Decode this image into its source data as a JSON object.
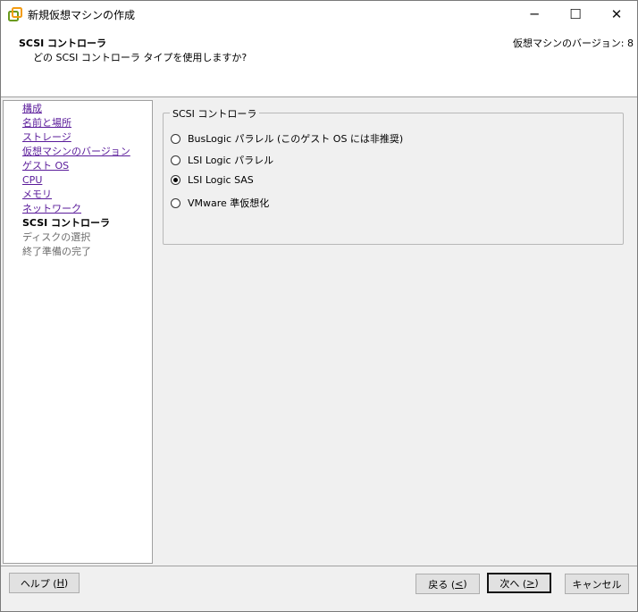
{
  "window": {
    "title": "新規仮想マシンの作成",
    "minimize_glyph": "─",
    "maximize_glyph": "☐",
    "close_glyph": "✕"
  },
  "header": {
    "title": "SCSI コントローラ",
    "subtitle": "どの SCSI コントローラ タイプを使用しますか?",
    "version": "仮想マシンのバージョン: 8"
  },
  "nav": {
    "items": [
      {
        "label": "構成",
        "state": "done"
      },
      {
        "label": "名前と場所",
        "state": "done"
      },
      {
        "label": "ストレージ",
        "state": "done"
      },
      {
        "label": "仮想マシンのバージョン",
        "state": "done"
      },
      {
        "label": "ゲスト OS",
        "state": "done"
      },
      {
        "label": "CPU",
        "state": "done"
      },
      {
        "label": "メモリ",
        "state": "done"
      },
      {
        "label": "ネットワーク",
        "state": "done"
      },
      {
        "label": "SCSI コントローラ",
        "state": "current"
      },
      {
        "label": "ディスクの選択",
        "state": "pending"
      },
      {
        "label": "終了準備の完了",
        "state": "pending"
      }
    ]
  },
  "controller_group": {
    "label": "SCSI コントローラ",
    "options": [
      {
        "label": "BusLogic パラレル (このゲスト OS には非推奨)",
        "selected": false
      },
      {
        "label": "LSI Logic パラレル",
        "selected": false
      },
      {
        "label": "LSI Logic SAS",
        "selected": true
      },
      {
        "label": "VMware 準仮想化",
        "selected": false
      }
    ]
  },
  "buttons": {
    "help": {
      "text": "ヘルプ (",
      "mnemonic": "H",
      "end": ")"
    },
    "back": {
      "text": "戻る (",
      "mnemonic": "<",
      "end": ")"
    },
    "next": {
      "text": "次へ (",
      "mnemonic": ">",
      "end": ")"
    },
    "cancel": {
      "text": "キャンセル"
    }
  },
  "colors": {
    "link": "#5a1b9a",
    "pending": "#6d6d6d",
    "dialog_bg": "#f0f0f0"
  }
}
